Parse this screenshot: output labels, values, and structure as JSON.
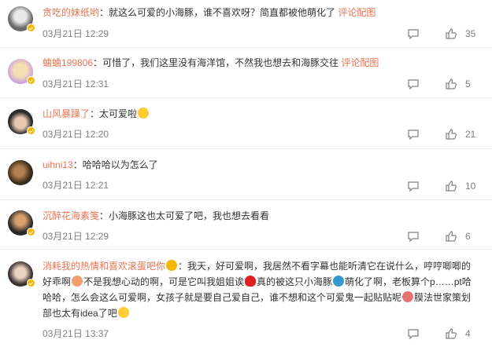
{
  "comments": [
    {
      "user": "贪吃的妹纸哟",
      "colon": "：",
      "text": "就这么可爱的小海豚，谁不喜欢呀？简直都被他萌化了",
      "link": "评论配图",
      "time": "03月21日 12:29",
      "likes": "35",
      "has_badge": true
    },
    {
      "user": "蛐蛐199806",
      "colon": "：",
      "text": "可惜了，我们这里没有海洋馆，不然我也想去和海豚交往",
      "link": "评论配图",
      "time": "03月21日 12:31",
      "likes": "5",
      "has_badge": true
    },
    {
      "user": "山风暴躁了",
      "colon": "：",
      "text": "太可爱啦",
      "time": "03月21日 12:20",
      "likes": "21",
      "has_badge": true
    },
    {
      "user": "uihni13",
      "colon": "：",
      "text": "哈哈哈以为怎么了",
      "time": "03月21日 12:21",
      "likes": "10",
      "has_badge": false
    },
    {
      "user": "沉醉花海素笺",
      "colon": "：",
      "text": "小海豚这也太可爱了吧，我也想去看看",
      "time": "03月21日 12:29",
      "likes": "6",
      "has_badge": true
    },
    {
      "user": "消耗我的热情和喜欢滚蛋吧你",
      "colon": "：",
      "time": "03月21日 13:37",
      "likes": "4",
      "has_badge": true,
      "text_parts": [
        "我天，好可爱啊，我居然不看字幕也能听清它在说什么，哼哼唧唧的",
        "好乖啊",
        "不是我想心动的啊，可是它叫我姐姐诶",
        "真的被这只小海豚",
        "萌化了啊，老板算个p……pt哈",
        "哈哈，怎么会这么可爱啊，女孩子就是要自己爱自己，谁不想和这个可爱鬼一起贴贴呢",
        "膜法世家策划",
        "部也太有idea了吧"
      ]
    }
  ],
  "icons": [
    "comment-icon",
    "like-icon",
    "verified-badge-icon"
  ],
  "colors": {
    "username": "#eb7350",
    "time": "#808080",
    "badge": "#f7b500",
    "separator": "#eeeeee"
  }
}
